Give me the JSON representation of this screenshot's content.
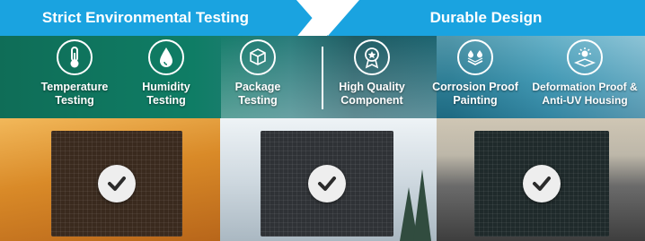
{
  "headers": {
    "left": "Strict Environmental Testing",
    "right": "Durable Design"
  },
  "features": [
    {
      "id": "temperature",
      "label": "Temperature\nTesting",
      "icon": "thermometer-icon"
    },
    {
      "id": "humidity",
      "label": "Humidity\nTesting",
      "icon": "water-drop-icon"
    },
    {
      "id": "package",
      "label": "Package\nTesting",
      "icon": "package-box-icon"
    },
    {
      "id": "quality",
      "label": "High Quality\nComponent",
      "icon": "medal-star-icon"
    },
    {
      "id": "corrosion",
      "label": "Corrosion Proof\nPainting",
      "icon": "corrosion-drops-icon"
    },
    {
      "id": "deformation",
      "label": "Deformation Proof &\nAnti-UV Housing",
      "icon": "sun-uv-icon"
    }
  ],
  "panels": [
    {
      "scene": "desert",
      "status": "check-icon"
    },
    {
      "scene": "snow",
      "status": "check-icon"
    },
    {
      "scene": "seaside-road",
      "status": "check-icon"
    }
  ],
  "colors": {
    "header_blue": "#1aa3e0",
    "band_green": "#0f7d65",
    "text_white": "#ffffff"
  }
}
